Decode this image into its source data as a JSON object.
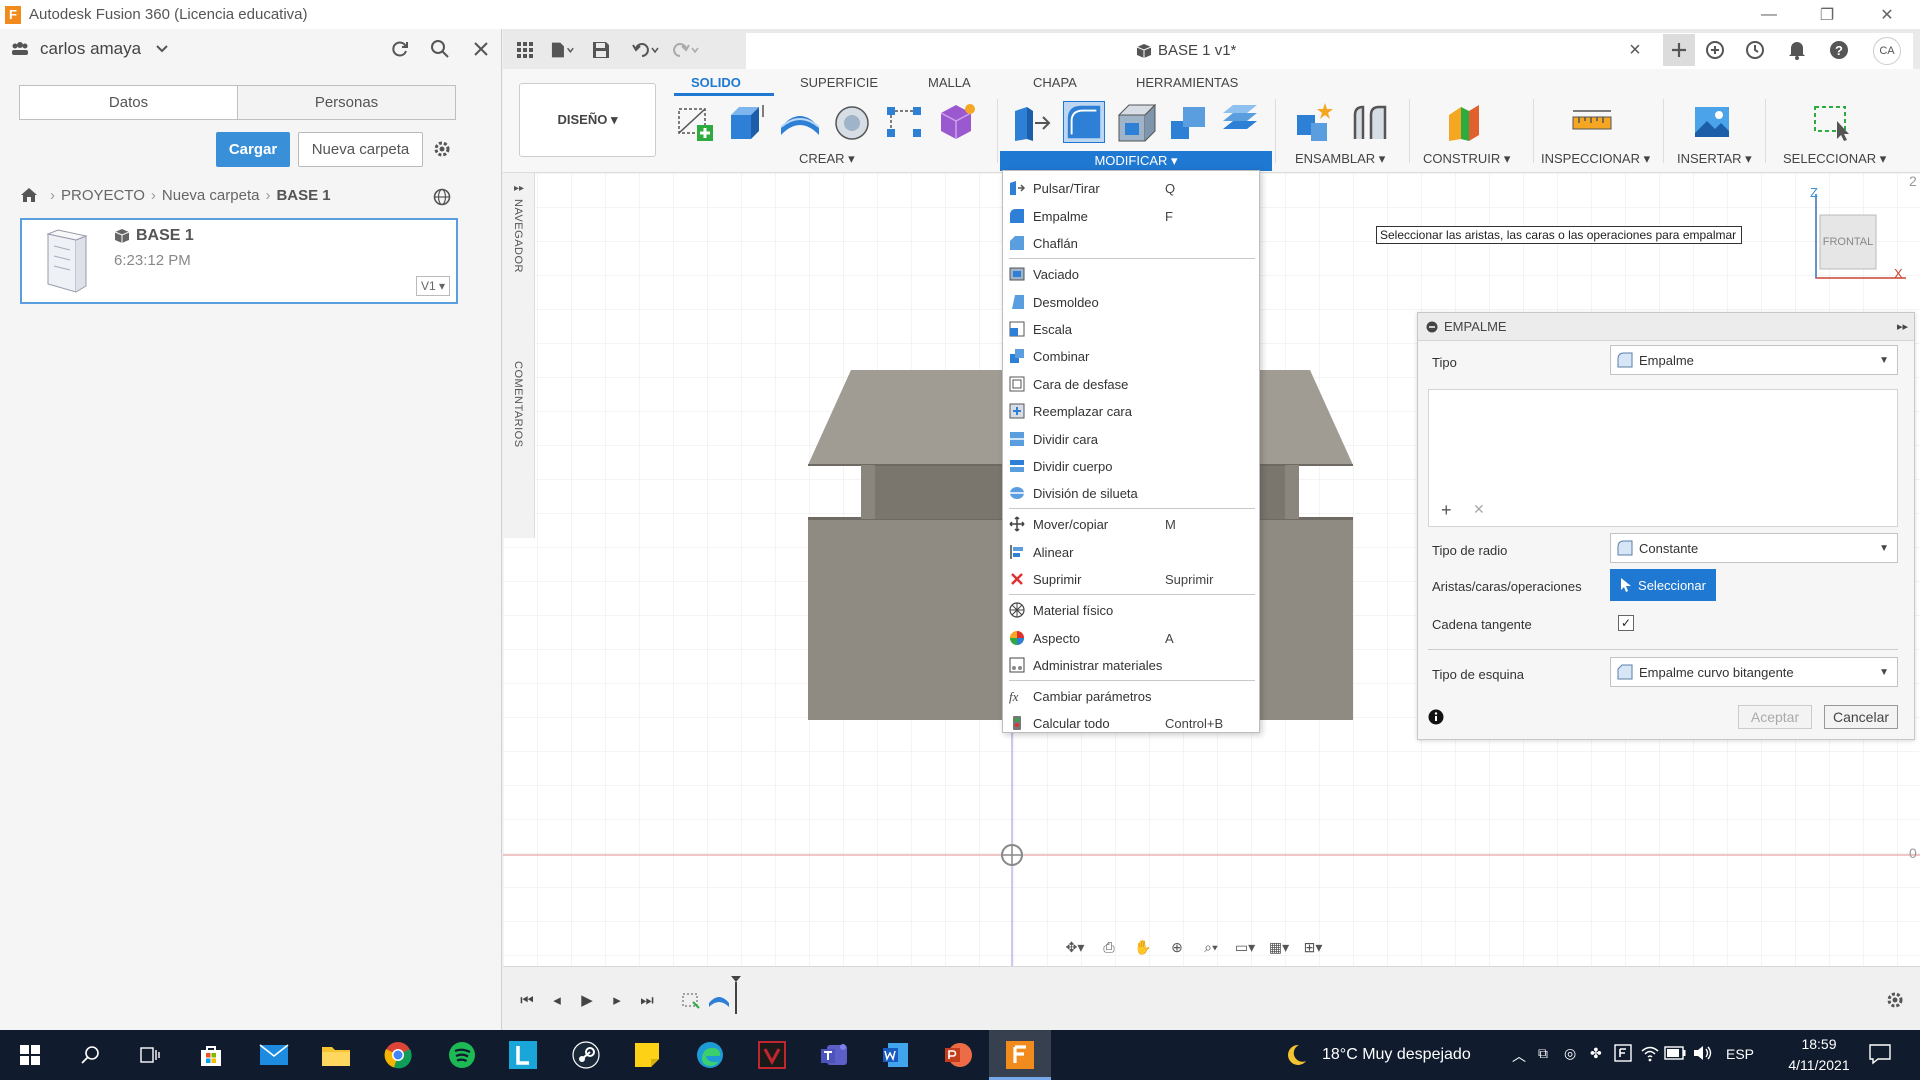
{
  "window": {
    "title": "Autodesk Fusion 360 (Licencia educativa)",
    "app_letter": "F"
  },
  "data_panel": {
    "user": "carlos amaya",
    "tabs": [
      "Datos",
      "Personas"
    ],
    "upload_label": "Cargar",
    "new_folder_label": "Nueva carpeta",
    "breadcrumb": [
      "PROYECTO",
      "Nueva carpeta",
      "BASE 1"
    ],
    "file": {
      "name": "BASE 1",
      "time": "6:23:12 PM",
      "version": "V1 ▾"
    }
  },
  "document": {
    "tab_title": "BASE 1 v1*",
    "close": "×",
    "avatar": "CA"
  },
  "toolbar": {
    "workspace": "DISEÑO ▾",
    "tabs": [
      "SOLIDO",
      "SUPERFICIE",
      "MALLA",
      "CHAPA",
      "HERRAMIENTAS"
    ],
    "groups": {
      "create": "CREAR ▾",
      "modify": "MODIFICAR ▾",
      "assemble": "ENSAMBLAR ▾",
      "construct": "CONSTRUIR ▾",
      "inspect": "INSPECCIONAR ▾",
      "insert": "INSERTAR ▾",
      "select": "SELECCIONAR ▾"
    }
  },
  "side_strip": {
    "navigator": "NAVEGADOR",
    "comments": "COMENTARIOS"
  },
  "modify_menu": {
    "items": [
      {
        "label": "Pulsar/Tirar",
        "shortcut": "Q"
      },
      {
        "label": "Empalme",
        "shortcut": "F"
      },
      {
        "label": "Chaflán",
        "shortcut": ""
      },
      {
        "label": "Vaciado",
        "shortcut": ""
      },
      {
        "label": "Desmoldeo",
        "shortcut": ""
      },
      {
        "label": "Escala",
        "shortcut": ""
      },
      {
        "label": "Combinar",
        "shortcut": ""
      },
      {
        "label": "Cara de desfase",
        "shortcut": ""
      },
      {
        "label": "Reemplazar cara",
        "shortcut": ""
      },
      {
        "label": "Dividir cara",
        "shortcut": ""
      },
      {
        "label": "Dividir cuerpo",
        "shortcut": ""
      },
      {
        "label": "División de silueta",
        "shortcut": ""
      },
      {
        "label": "Mover/copiar",
        "shortcut": "M"
      },
      {
        "label": "Alinear",
        "shortcut": ""
      },
      {
        "label": "Suprimir",
        "shortcut": "Suprimir"
      },
      {
        "label": "Material físico",
        "shortcut": ""
      },
      {
        "label": "Aspecto",
        "shortcut": "A"
      },
      {
        "label": "Administrar materiales",
        "shortcut": ""
      },
      {
        "label": "Cambiar parámetros",
        "shortcut": ""
      },
      {
        "label": "Calcular todo",
        "shortcut": "Control+B"
      }
    ]
  },
  "tooltip": "Seleccionar las aristas, las caras o las operaciones para empalmar",
  "viewcube": {
    "face": "FRONTAL",
    "axis_z": "Z",
    "axis_x": "X"
  },
  "ruler": {
    "top": "2",
    "mid": "0"
  },
  "fillet_panel": {
    "title": "EMPALME",
    "type_label": "Tipo",
    "type_value": "Empalme",
    "radius_type_label": "Tipo de radio",
    "radius_type_value": "Constante",
    "edges_label": "Aristas/caras/operaciones",
    "select_button": "Seleccionar",
    "tangent_chain_label": "Cadena tangente",
    "tangent_chain_checked": true,
    "corner_type_label": "Tipo de esquina",
    "corner_type_value": "Empalme curvo bitangente",
    "ok_label": "Aceptar",
    "cancel_label": "Cancelar"
  },
  "taskbar": {
    "weather": "18°C  Muy despejado",
    "language": "ESP",
    "time": "18:59",
    "date": "4/11/2021"
  },
  "colors": {
    "accent": "#1f78d1",
    "model": "#8f8b82",
    "taskbar": "#101b2d"
  }
}
